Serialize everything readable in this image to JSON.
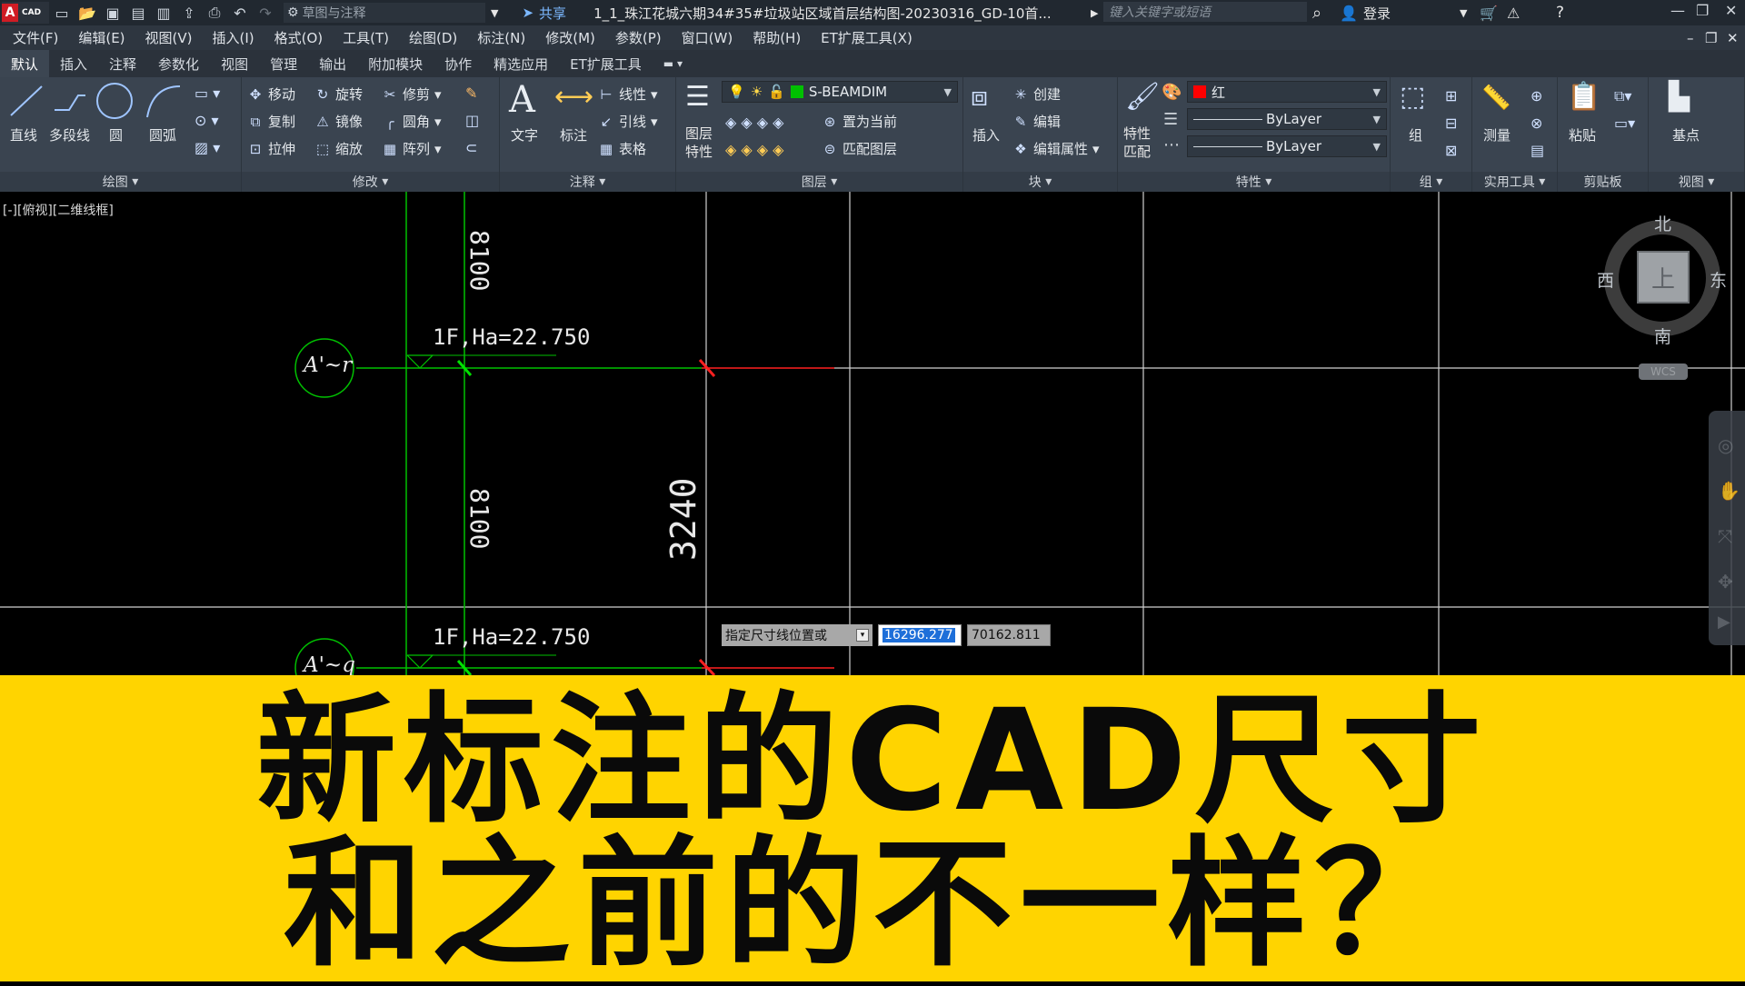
{
  "titlebar": {
    "logo_text": "CAD",
    "workspace": "草图与注释",
    "share": "共享",
    "doc_title": "1_1_珠江花城六期34#35#垃圾站区域首层结构图-20230316_GD-10首...",
    "search_placeholder": "键入关键字或短语",
    "login": "登录"
  },
  "menu": [
    "文件(F)",
    "编辑(E)",
    "视图(V)",
    "插入(I)",
    "格式(O)",
    "工具(T)",
    "绘图(D)",
    "标注(N)",
    "修改(M)",
    "参数(P)",
    "窗口(W)",
    "帮助(H)",
    "ET扩展工具(X)"
  ],
  "ribbon_tabs": [
    "默认",
    "插入",
    "注释",
    "参数化",
    "视图",
    "管理",
    "输出",
    "附加模块",
    "协作",
    "精选应用",
    "ET扩展工具"
  ],
  "panels": {
    "draw": {
      "label": "绘图",
      "line": "直线",
      "polyline": "多段线",
      "circle": "圆",
      "arc": "圆弧"
    },
    "modify": {
      "label": "修改",
      "move": "移动",
      "rotate": "旋转",
      "trim": "修剪",
      "copy": "复制",
      "mirror": "镜像",
      "fillet": "圆角",
      "stretch": "拉伸",
      "scale": "缩放",
      "array": "阵列"
    },
    "annotate": {
      "label": "注释",
      "text": "文字",
      "dimension": "标注",
      "linear": "线性",
      "leader": "引线",
      "table": "表格"
    },
    "layers": {
      "label": "图层",
      "properties": "图层\n特性",
      "props_line1": "图层",
      "props_line2": "特性",
      "current_layer": "S-BEAMDIM",
      "set_current": "置为当前",
      "match_layer": "匹配图层"
    },
    "block": {
      "label": "块",
      "insert": "插入",
      "create": "创建",
      "edit": "编辑",
      "edit_attr": "编辑属性"
    },
    "properties": {
      "label": "特性",
      "match_line1": "特性",
      "match_line2": "匹配",
      "color": "红",
      "linetype": "ByLayer",
      "lineweight": "ByLayer"
    },
    "groups": {
      "label": "组",
      "group": "组"
    },
    "utilities": {
      "label": "实用工具",
      "measure": "测量"
    },
    "clipboard": {
      "label": "剪贴板",
      "paste": "粘贴"
    },
    "view": {
      "label": "视图",
      "base": "基点"
    }
  },
  "viewport_label": "[-][俯视][二维线框]",
  "viewcube": {
    "north": "北",
    "south": "南",
    "east": "东",
    "west": "西",
    "top": "上",
    "wcs": "WCS"
  },
  "drawing": {
    "dim_top": "8100",
    "dim_mid": "8100",
    "dim_vertical": "3240",
    "level_upper": "1F,Ha=22.750",
    "level_lower": "1F,Ha=22.750",
    "axis_upper": "A'~r",
    "axis_lower": "A'~q"
  },
  "command": {
    "prompt": "指定尺寸线位置或",
    "x_value": "16296.277",
    "y_value": "70162.811"
  },
  "banner": {
    "line1": "新标注的CAD尺寸",
    "line2": "和之前的不一样？"
  },
  "colors": {
    "accent_red": "#ff0000",
    "layer_green": "#00c000",
    "banner_yellow": "#ffd400"
  }
}
